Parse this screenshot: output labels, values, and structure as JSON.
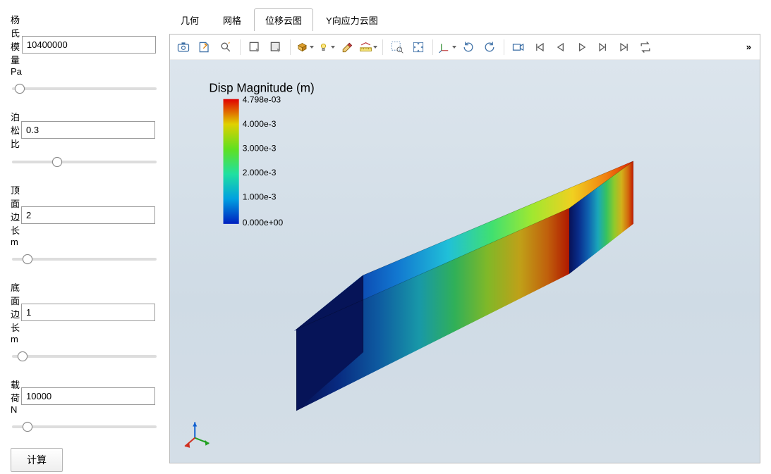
{
  "sidebar": {
    "youngs_modulus": {
      "label": "杨氏模量 Pa",
      "value": "10400000"
    },
    "poisson_ratio": {
      "label": "泊松比",
      "value": "0.3"
    },
    "top_edge": {
      "label": "顶面边长 m",
      "value": "2"
    },
    "bottom_edge": {
      "label": "底面边长 m",
      "value": "1"
    },
    "load": {
      "label": "载荷 N",
      "value": "10000"
    },
    "calc_btn": "计算"
  },
  "tabs": [
    {
      "label": "几何",
      "active": false
    },
    {
      "label": "网格",
      "active": false
    },
    {
      "label": "位移云图",
      "active": true
    },
    {
      "label": "Y向应力云图",
      "active": false
    }
  ],
  "legend": {
    "title": "Disp Magnitude (m)",
    "ticks": [
      "4.798e-03",
      "4.000e-3",
      "3.000e-3",
      "2.000e-3",
      "1.000e-3",
      "0.000e+00"
    ]
  },
  "toolbar_more": "»"
}
